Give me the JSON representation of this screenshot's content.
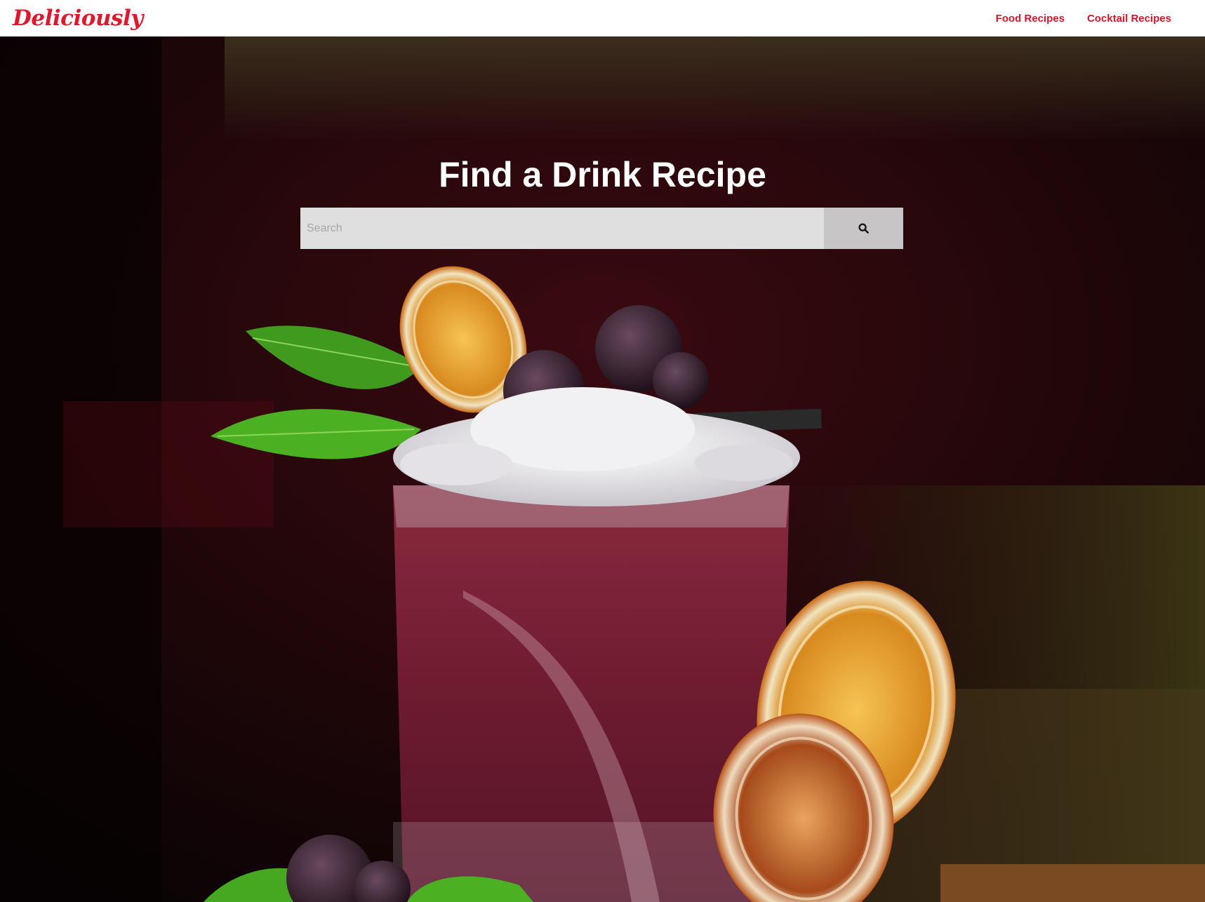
{
  "header": {
    "brand": "Deliciously",
    "brand_color": "#e0182d",
    "nav": [
      {
        "label": "Food Recipes"
      },
      {
        "label": "Cocktail Recipes"
      }
    ]
  },
  "hero": {
    "title": "Find a Drink Recipe",
    "search": {
      "placeholder": "Search",
      "value": "",
      "button_icon": "search-icon"
    },
    "background_image": "blackberry-cocktail-photo"
  }
}
